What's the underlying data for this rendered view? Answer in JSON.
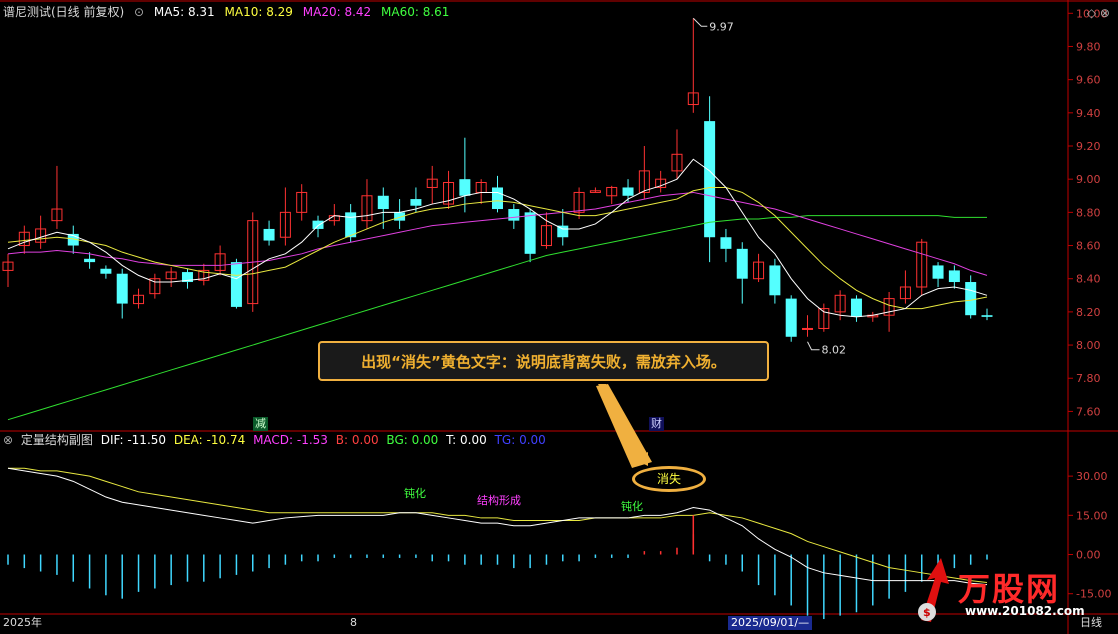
{
  "header": {
    "title": "谱尼测试(日线 前复权)",
    "ma5": "MA5: 8.31",
    "ma10": "MA10: 8.29",
    "ma20": "MA20: 8.42",
    "ma60": "MA60: 8.61",
    "colors": {
      "title": "#d8d8d8",
      "ma5": "#ffffff",
      "ma10": "#ffff40",
      "ma20": "#ff40ff",
      "ma60": "#40ff40"
    }
  },
  "top_right_icons": "◇ ⊗",
  "price_axis": {
    "ticks": [
      "10.00",
      "9.80",
      "9.60",
      "9.40",
      "9.20",
      "9.00",
      "8.80",
      "8.60",
      "8.40",
      "8.20",
      "8.00",
      "7.80",
      "7.60"
    ],
    "min": 7.5,
    "max": 10.05
  },
  "price_labels": {
    "high": "9.97",
    "low": "8.02"
  },
  "markers": {
    "jian": "减",
    "cai": "财"
  },
  "callout": "出现“消失”黄色文字：说明底背离失败，需放弃入场。",
  "sub_panel": {
    "title": "定量结构副图",
    "dif": "DIF: -11.50",
    "dea": "DEA: -10.74",
    "macd": "MACD: -1.53",
    "b": "B: 0.00",
    "bg": "BG: 0.00",
    "t": "T: 0.00",
    "tg": "TG: 0.00",
    "ticks": [
      "30.00",
      "15.00",
      "0.00",
      "-15.00"
    ],
    "annotations": {
      "dunhua1": "钝化",
      "jiegou": "结构形成",
      "dunhua2": "钝化",
      "xiaoshi": "消失"
    }
  },
  "bottom_bar": {
    "year": "2025年",
    "month": "8",
    "date": "2025/09/01/—",
    "period": "日线"
  },
  "logo": {
    "name": "万股网",
    "url": "www.201082.com"
  },
  "chart_data": {
    "type": "candlestick",
    "candles": [
      [
        8.45,
        8.5,
        8.35,
        8.55
      ],
      [
        8.6,
        8.68,
        8.55,
        8.72
      ],
      [
        8.62,
        8.7,
        8.58,
        8.78
      ],
      [
        8.75,
        8.82,
        8.7,
        9.08
      ],
      [
        8.67,
        8.6,
        8.55,
        8.72
      ],
      [
        8.52,
        8.5,
        8.46,
        8.56
      ],
      [
        8.46,
        8.43,
        8.4,
        8.48
      ],
      [
        8.43,
        8.25,
        8.16,
        8.46
      ],
      [
        8.25,
        8.3,
        8.22,
        8.34
      ],
      [
        8.31,
        8.4,
        8.28,
        8.43
      ],
      [
        8.4,
        8.44,
        8.35,
        8.47
      ],
      [
        8.44,
        8.38,
        8.34,
        8.46
      ],
      [
        8.39,
        8.45,
        8.36,
        8.49
      ],
      [
        8.45,
        8.55,
        8.42,
        8.6
      ],
      [
        8.5,
        8.23,
        8.22,
        8.52
      ],
      [
        8.25,
        8.75,
        8.2,
        8.8
      ],
      [
        8.7,
        8.63,
        8.6,
        8.75
      ],
      [
        8.65,
        8.8,
        8.6,
        8.95
      ],
      [
        8.8,
        8.92,
        8.75,
        8.97
      ],
      [
        8.75,
        8.7,
        8.65,
        8.78
      ],
      [
        8.75,
        8.78,
        8.72,
        8.85
      ],
      [
        8.8,
        8.65,
        8.62,
        8.85
      ],
      [
        8.75,
        8.9,
        8.7,
        9.0
      ],
      [
        8.9,
        8.82,
        8.7,
        8.95
      ],
      [
        8.8,
        8.75,
        8.7,
        8.88
      ],
      [
        8.88,
        8.84,
        8.8,
        8.95
      ],
      [
        8.95,
        9.0,
        8.85,
        9.08
      ],
      [
        8.85,
        8.98,
        8.82,
        9.05
      ],
      [
        9.0,
        8.9,
        8.8,
        9.25
      ],
      [
        8.92,
        8.98,
        8.85,
        9.0
      ],
      [
        8.95,
        8.82,
        8.8,
        9.02
      ],
      [
        8.82,
        8.75,
        8.7,
        8.85
      ],
      [
        8.8,
        8.55,
        8.5,
        8.82
      ],
      [
        8.6,
        8.72,
        8.58,
        8.8
      ],
      [
        8.72,
        8.65,
        8.6,
        8.82
      ],
      [
        8.8,
        8.92,
        8.76,
        8.95
      ],
      [
        8.92,
        8.93,
        8.92,
        8.95
      ],
      [
        8.9,
        8.95,
        8.85,
        8.96
      ],
      [
        8.95,
        8.9,
        8.86,
        9.0
      ],
      [
        8.92,
        9.05,
        8.88,
        9.2
      ],
      [
        8.95,
        9.0,
        8.92,
        9.05
      ],
      [
        9.05,
        9.15,
        9.0,
        9.3
      ],
      [
        9.45,
        9.52,
        9.4,
        9.97
      ],
      [
        9.35,
        8.65,
        8.5,
        9.5
      ],
      [
        8.65,
        8.58,
        8.5,
        8.7
      ],
      [
        8.58,
        8.4,
        8.25,
        8.62
      ],
      [
        8.4,
        8.5,
        8.38,
        8.55
      ],
      [
        8.48,
        8.3,
        8.25,
        8.52
      ],
      [
        8.28,
        8.05,
        8.02,
        8.3
      ],
      [
        8.1,
        8.1,
        8.05,
        8.18
      ],
      [
        8.1,
        8.22,
        8.08,
        8.25
      ],
      [
        8.2,
        8.3,
        8.15,
        8.33
      ],
      [
        8.28,
        8.17,
        8.14,
        8.3
      ],
      [
        8.17,
        8.18,
        8.14,
        8.2
      ],
      [
        8.18,
        8.28,
        8.08,
        8.32
      ],
      [
        8.28,
        8.35,
        8.25,
        8.45
      ],
      [
        8.35,
        8.62,
        8.3,
        8.64
      ],
      [
        8.48,
        8.4,
        8.35,
        8.5
      ],
      [
        8.45,
        8.38,
        8.34,
        8.48
      ],
      [
        8.38,
        8.18,
        8.16,
        8.42
      ],
      [
        8.18,
        8.17,
        8.15,
        8.22
      ]
    ],
    "ma5": [
      8.58,
      8.62,
      8.65,
      8.68,
      8.66,
      8.62,
      8.56,
      8.48,
      8.42,
      8.38,
      8.38,
      8.39,
      8.4,
      8.43,
      8.4,
      8.46,
      8.52,
      8.55,
      8.62,
      8.72,
      8.78,
      8.77,
      8.78,
      8.8,
      8.8,
      8.82,
      8.85,
      8.87,
      8.9,
      8.92,
      8.92,
      8.88,
      8.82,
      8.75,
      8.7,
      8.7,
      8.73,
      8.8,
      8.88,
      8.93,
      8.96,
      9.0,
      9.12,
      9.05,
      8.95,
      8.8,
      8.65,
      8.55,
      8.4,
      8.28,
      8.2,
      8.18,
      8.17,
      8.18,
      8.2,
      8.22,
      8.3,
      8.34,
      8.35,
      8.33,
      8.3
    ],
    "ma10": [
      8.62,
      8.63,
      8.64,
      8.65,
      8.64,
      8.62,
      8.6,
      8.56,
      8.53,
      8.5,
      8.48,
      8.46,
      8.44,
      8.43,
      8.42,
      8.43,
      8.45,
      8.47,
      8.52,
      8.57,
      8.62,
      8.66,
      8.7,
      8.74,
      8.77,
      8.8,
      8.82,
      8.83,
      8.85,
      8.86,
      8.87,
      8.86,
      8.84,
      8.82,
      8.8,
      8.78,
      8.78,
      8.8,
      8.82,
      8.84,
      8.86,
      8.88,
      8.93,
      8.95,
      8.95,
      8.92,
      8.86,
      8.78,
      8.68,
      8.58,
      8.48,
      8.4,
      8.33,
      8.28,
      8.24,
      8.22,
      8.22,
      8.24,
      8.26,
      8.27,
      8.29
    ],
    "ma20": [
      8.55,
      8.56,
      8.56,
      8.57,
      8.56,
      8.55,
      8.53,
      8.52,
      8.5,
      8.49,
      8.48,
      8.48,
      8.48,
      8.48,
      8.49,
      8.5,
      8.51,
      8.53,
      8.55,
      8.58,
      8.6,
      8.62,
      8.64,
      8.66,
      8.68,
      8.7,
      8.72,
      8.73,
      8.74,
      8.75,
      8.76,
      8.77,
      8.78,
      8.79,
      8.8,
      8.81,
      8.82,
      8.84,
      8.86,
      8.88,
      8.9,
      8.91,
      8.92,
      8.9,
      8.88,
      8.86,
      8.84,
      8.82,
      8.79,
      8.76,
      8.73,
      8.7,
      8.67,
      8.64,
      8.61,
      8.58,
      8.55,
      8.52,
      8.49,
      8.45,
      8.42
    ],
    "ma60": [
      7.55,
      7.58,
      7.61,
      7.64,
      7.67,
      7.7,
      7.73,
      7.76,
      7.79,
      7.82,
      7.85,
      7.88,
      7.91,
      7.94,
      7.97,
      8.0,
      8.03,
      8.06,
      8.09,
      8.12,
      8.15,
      8.18,
      8.21,
      8.24,
      8.27,
      8.3,
      8.33,
      8.36,
      8.39,
      8.42,
      8.45,
      8.48,
      8.51,
      8.54,
      8.56,
      8.58,
      8.6,
      8.62,
      8.64,
      8.66,
      8.68,
      8.7,
      8.72,
      8.74,
      8.75,
      8.76,
      8.76,
      8.77,
      8.77,
      8.78,
      8.78,
      8.78,
      8.78,
      8.78,
      8.78,
      8.78,
      8.78,
      8.78,
      8.77,
      8.77,
      8.77
    ],
    "sub_range": [
      -22,
      40
    ],
    "dif": [
      33,
      32,
      31,
      30,
      28,
      25,
      22,
      20,
      19,
      18,
      17,
      16,
      15,
      14,
      13,
      12,
      13,
      14,
      14.5,
      15,
      15,
      15,
      15,
      15,
      16,
      16,
      15,
      14,
      13,
      12,
      12,
      11,
      11,
      12,
      13,
      14,
      14,
      14,
      14,
      15,
      15,
      16,
      18,
      17,
      14,
      11,
      6,
      2,
      -1,
      -5,
      -7,
      -8,
      -9,
      -10,
      -10,
      -10,
      -10,
      -10,
      -10,
      -11,
      -11.5
    ],
    "dea": [
      33,
      33,
      32,
      32,
      31,
      30,
      28,
      26,
      24,
      23,
      22,
      21,
      20,
      19,
      18,
      17,
      16,
      16,
      16,
      16,
      16,
      16,
      16,
      16,
      16,
      16,
      16,
      15,
      15,
      14,
      14,
      13,
      13,
      13,
      13,
      13,
      14,
      14,
      14,
      14,
      14,
      15,
      15,
      16,
      15,
      14,
      12,
      10,
      8,
      5,
      3,
      1,
      -1,
      -3,
      -5,
      -6,
      -7,
      -8,
      -9,
      -10,
      -10.7
    ],
    "macd": [
      -3,
      -4,
      -5,
      -6,
      -8,
      -10,
      -12,
      -13,
      -11,
      -10,
      -9,
      -8,
      -8,
      -7,
      -6,
      -5,
      -4,
      -3,
      -2,
      -2,
      -1,
      -1,
      -1,
      -1,
      -1,
      -1,
      -2,
      -2,
      -3,
      -3,
      -3,
      -4,
      -4,
      -3,
      -2,
      -2,
      -1,
      -1,
      -1,
      1,
      1,
      2,
      6,
      -2,
      -3,
      -5,
      -9,
      -12,
      -15,
      -18,
      -19,
      -18,
      -17,
      -15,
      -13,
      -11,
      -8,
      -6,
      -4,
      -3,
      -1.5
    ]
  }
}
